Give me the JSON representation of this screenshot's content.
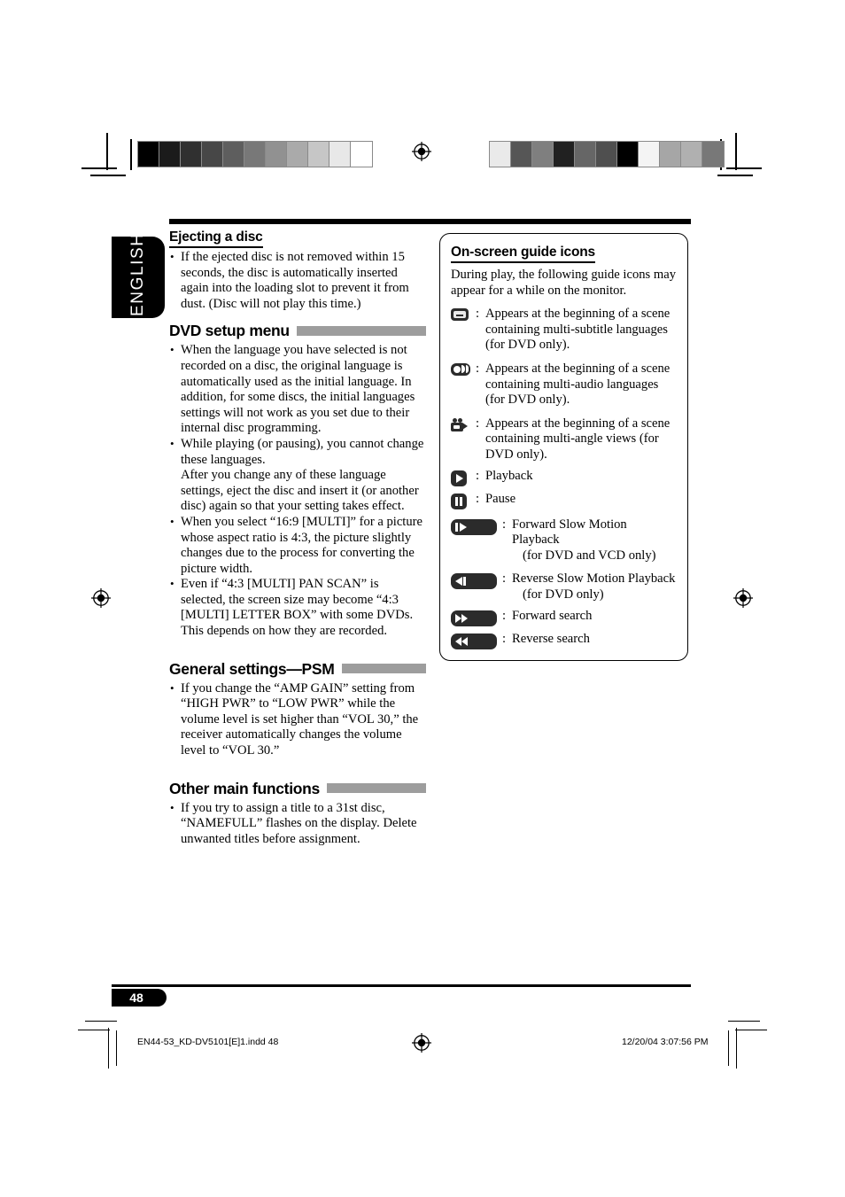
{
  "page": {
    "language_tab": "ENGLISH",
    "page_number": "48"
  },
  "left_column": {
    "sections": [
      {
        "id": "ejecting",
        "heading": "Ejecting a disc",
        "heading_style": "underline",
        "bullets": [
          "If the ejected disc is not removed within 15 seconds, the disc is automatically inserted again into the loading slot to prevent it from dust. (Disc will not play this time.)"
        ]
      },
      {
        "id": "dvd-setup-menu",
        "heading": "DVD setup menu",
        "heading_style": "bar",
        "bullets": [
          "When the language you have selected is not recorded on a disc, the original language is automatically used as the initial language. In addition, for some discs, the initial languages settings will not work as you set due to their internal disc programming.",
          "While playing (or pausing), you cannot change these languages.",
          "When you select “16:9 [MULTI]” for a picture whose aspect ratio is 4:3, the picture slightly changes due to the process for converting the picture width.",
          "Even if “4:3 [MULTI] PAN SCAN” is selected, the screen size may become “4:3 [MULTI] LETTER BOX” with some DVDs. This depends on how they are recorded."
        ],
        "bullet2_continuation": "After you change any of these language settings, eject the disc and insert it (or another disc) again so that your setting takes effect."
      },
      {
        "id": "general-settings-psm",
        "heading": "General settings—PSM",
        "heading_style": "bar",
        "bullets": [
          "If you change the “AMP GAIN” setting from “HIGH PWR” to “LOW PWR” while the volume level is set higher than “VOL 30,” the receiver automatically changes the volume level to “VOL 30.”"
        ]
      },
      {
        "id": "other-main-functions",
        "heading": "Other main functions",
        "heading_style": "bar",
        "bullets": [
          "If you try to assign a title to a 31st disc, “NAMEFULL” flashes on the display. Delete unwanted titles before assignment."
        ]
      }
    ]
  },
  "right_column": {
    "box": {
      "heading": "On-screen guide icons",
      "intro": "During play, the following guide icons may appear for a while on the monitor.",
      "items": [
        {
          "icon": "multi-subtitle-icon",
          "icon_kind": "subtitle",
          "wide": false,
          "separator": ":",
          "text": "Appears at the beginning of a scene containing multi-subtitle languages (for DVD only)."
        },
        {
          "icon": "multi-audio-icon",
          "icon_kind": "audio",
          "wide": false,
          "separator": ":",
          "text": "Appears at the beginning of a scene containing multi-audio languages (for DVD only)."
        },
        {
          "icon": "multi-angle-icon",
          "icon_kind": "angle",
          "wide": false,
          "separator": ":",
          "text": "Appears at the beginning of a scene containing multi-angle views (for DVD only)."
        },
        {
          "icon": "playback-icon",
          "icon_kind": "play",
          "wide": false,
          "separator": ":",
          "text": "Playback"
        },
        {
          "icon": "pause-icon",
          "icon_kind": "pause",
          "wide": false,
          "separator": ":",
          "text": "Pause"
        },
        {
          "icon": "forward-slow-motion-icon",
          "icon_kind": "slow-forward",
          "wide": true,
          "separator": ":",
          "text": "Forward Slow Motion Playback",
          "text2": "(for DVD and VCD only)"
        },
        {
          "icon": "reverse-slow-motion-icon",
          "icon_kind": "slow-reverse",
          "wide": true,
          "separator": ":",
          "text": "Reverse Slow Motion Playback",
          "text2": "(for DVD only)"
        },
        {
          "icon": "forward-search-icon",
          "icon_kind": "fast-forward",
          "wide": true,
          "separator": ":",
          "text": "Forward search"
        },
        {
          "icon": "reverse-search-icon",
          "icon_kind": "fast-reverse",
          "wide": true,
          "separator": ":",
          "text": "Reverse search"
        }
      ]
    }
  },
  "footer": {
    "file_name": "EN44-53_KD-DV5101[E]1.indd   48",
    "timestamp": "12/20/04   3:07:56 PM"
  },
  "print_marks": {
    "step_wedge_left": [
      "#000000",
      "#1b1b1b",
      "#303030",
      "#474747",
      "#5e5e5e",
      "#787878",
      "#919191",
      "#aaaaaa",
      "#c6c6c6",
      "#e8e8e8",
      "#ffffff"
    ],
    "step_wedge_right": [
      "#eaeaea",
      "#565656",
      "#7f7f7f",
      "#212121",
      "#666666",
      "#4f4f4f",
      "#000000",
      "#f4f4f4",
      "#a6a6a6",
      "#b0b0b0",
      "#787878"
    ]
  }
}
